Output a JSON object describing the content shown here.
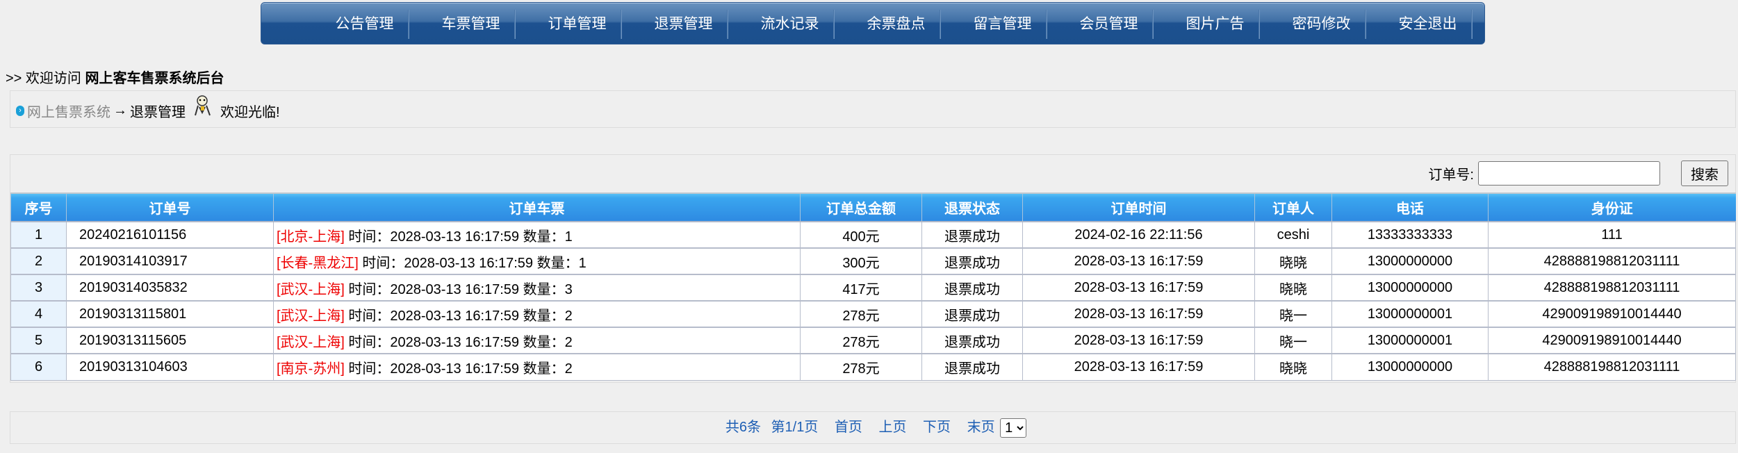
{
  "nav": [
    "公告管理",
    "车票管理",
    "订单管理",
    "退票管理",
    "流水记录",
    "余票盘点",
    "留言管理",
    "会员管理",
    "图片广告",
    "密码修改",
    "安全退出"
  ],
  "welcome": {
    "prefix": ">> 欢迎访问",
    "site": "网上客车售票系统后台"
  },
  "breadcrumb": {
    "home": "网上售票系统",
    "arrow": "→",
    "current": "退票管理",
    "greeting": "欢迎光临!"
  },
  "search": {
    "label": "订单号:",
    "value": "",
    "button": "搜索"
  },
  "table": {
    "headers": [
      "序号",
      "订单号",
      "订单车票",
      "订单总金额",
      "退票状态",
      "订单时间",
      "订单人",
      "电话",
      "身份证"
    ],
    "rows": [
      {
        "no": "1",
        "order": "20240216101156",
        "route": "[北京-上海]",
        "ticket": "时间：2028-03-13 16:17:59 数量：1",
        "amount": "400元",
        "status": "退票成功",
        "time": "2024-02-16 22:11:56",
        "user": "ceshi",
        "phone": "13333333333",
        "id": "111"
      },
      {
        "no": "2",
        "order": "20190314103917",
        "route": "[长春-黑龙江]",
        "ticket": "时间：2028-03-13 16:17:59 数量：1",
        "amount": "300元",
        "status": "退票成功",
        "time": "2028-03-13 16:17:59",
        "user": "晓晓",
        "phone": "13000000000",
        "id": "428888198812031111"
      },
      {
        "no": "3",
        "order": "20190314035832",
        "route": "[武汉-上海]",
        "ticket": "时间：2028-03-13 16:17:59 数量：3",
        "amount": "417元",
        "status": "退票成功",
        "time": "2028-03-13 16:17:59",
        "user": "晓晓",
        "phone": "13000000000",
        "id": "428888198812031111"
      },
      {
        "no": "4",
        "order": "20190313115801",
        "route": "[武汉-上海]",
        "ticket": "时间：2028-03-13 16:17:59 数量：2",
        "amount": "278元",
        "status": "退票成功",
        "time": "2028-03-13 16:17:59",
        "user": "晓一",
        "phone": "13000000001",
        "id": "429009198910014440"
      },
      {
        "no": "5",
        "order": "20190313115605",
        "route": "[武汉-上海]",
        "ticket": "时间：2028-03-13 16:17:59 数量：2",
        "amount": "278元",
        "status": "退票成功",
        "time": "2028-03-13 16:17:59",
        "user": "晓一",
        "phone": "13000000001",
        "id": "429009198910014440"
      },
      {
        "no": "6",
        "order": "20190313104603",
        "route": "[南京-苏州]",
        "ticket": "时间：2028-03-13 16:17:59 数量：2",
        "amount": "278元",
        "status": "退票成功",
        "time": "2028-03-13 16:17:59",
        "user": "晓晓",
        "phone": "13000000000",
        "id": "428888198812031111"
      }
    ]
  },
  "pager": {
    "total": "共6条",
    "page": "第1/1页",
    "first": "首页",
    "prev": "上页",
    "next": "下页",
    "last": "末页",
    "select": "1"
  }
}
